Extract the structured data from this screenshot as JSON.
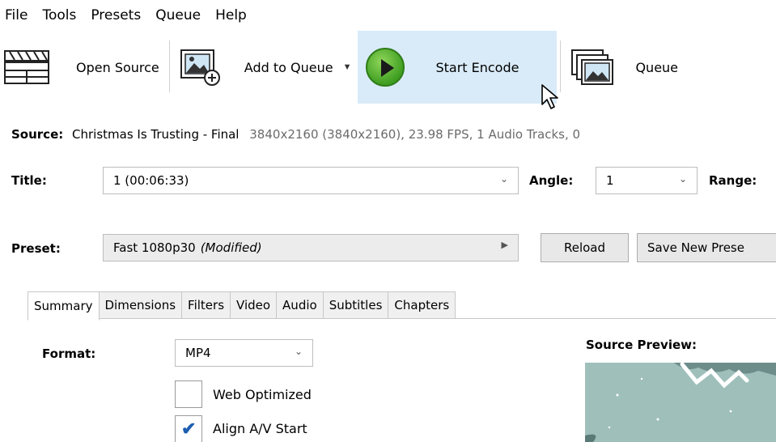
{
  "menu": [
    "File",
    "Tools",
    "Presets",
    "Queue",
    "Help"
  ],
  "toolbar": {
    "open_source": "Open Source",
    "add_to_queue": "Add to Queue",
    "start_encode": "Start Encode",
    "queue": "Queue"
  },
  "source": {
    "label": "Source:",
    "name": "Christmas Is Trusting - Final",
    "info": "3840x2160 (3840x2160), 23.98 FPS, 1 Audio Tracks, 0"
  },
  "title_row": {
    "title_label": "Title:",
    "title_value": "1  (00:06:33)",
    "angle_label": "Angle:",
    "angle_value": "1",
    "range_label": "Range:"
  },
  "preset_row": {
    "label": "Preset:",
    "value": "Fast 1080p30",
    "modified": "(Modified)",
    "reload": "Reload",
    "save_new": "Save New Prese"
  },
  "tabs": [
    "Summary",
    "Dimensions",
    "Filters",
    "Video",
    "Audio",
    "Subtitles",
    "Chapters"
  ],
  "summary": {
    "format_label": "Format:",
    "format_value": "MP4",
    "web_optimized": "Web Optimized",
    "web_optimized_checked": false,
    "align_av": "Align A/V Start",
    "align_av_checked": true,
    "source_preview_label": "Source Preview:"
  }
}
